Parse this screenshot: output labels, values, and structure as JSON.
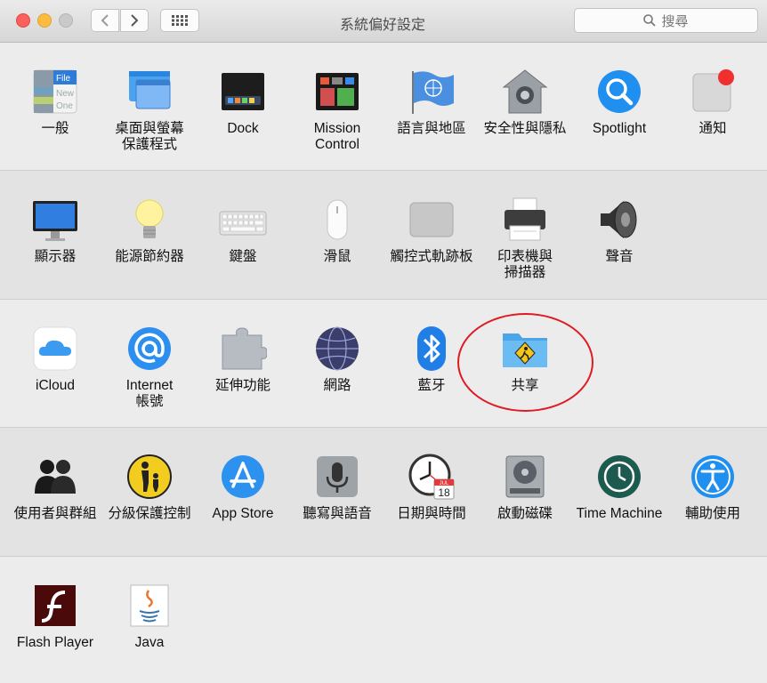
{
  "window": {
    "title": "系統偏好設定"
  },
  "search": {
    "placeholder": "搜尋"
  },
  "sections": [
    {
      "items": [
        {
          "label": "一般",
          "icon": "general-icon"
        },
        {
          "label": "桌面與螢幕\n保護程式",
          "icon": "desktop-screensaver-icon"
        },
        {
          "label": "Dock",
          "icon": "dock-icon"
        },
        {
          "label": "Mission\nControl",
          "icon": "mission-control-icon"
        },
        {
          "label": "語言與地區",
          "icon": "language-region-icon"
        },
        {
          "label": "安全性與隱私",
          "icon": "security-privacy-icon"
        },
        {
          "label": "Spotlight",
          "icon": "spotlight-icon"
        },
        {
          "label": "通知",
          "icon": "notifications-icon"
        }
      ]
    },
    {
      "items": [
        {
          "label": "顯示器",
          "icon": "displays-icon"
        },
        {
          "label": "能源節約器",
          "icon": "energy-saver-icon"
        },
        {
          "label": "鍵盤",
          "icon": "keyboard-icon"
        },
        {
          "label": "滑鼠",
          "icon": "mouse-icon"
        },
        {
          "label": "觸控式軌跡板",
          "icon": "trackpad-icon"
        },
        {
          "label": "印表機與\n掃描器",
          "icon": "printers-scanners-icon"
        },
        {
          "label": "聲音",
          "icon": "sound-icon"
        }
      ]
    },
    {
      "items": [
        {
          "label": "iCloud",
          "icon": "icloud-icon"
        },
        {
          "label": "Internet\n帳號",
          "icon": "internet-accounts-icon"
        },
        {
          "label": "延伸功能",
          "icon": "extensions-icon"
        },
        {
          "label": "網路",
          "icon": "network-icon"
        },
        {
          "label": "藍牙",
          "icon": "bluetooth-icon"
        },
        {
          "label": "共享",
          "icon": "sharing-icon"
        }
      ]
    },
    {
      "items": [
        {
          "label": "使用者與群組",
          "icon": "users-groups-icon"
        },
        {
          "label": "分級保護控制",
          "icon": "parental-controls-icon"
        },
        {
          "label": "App Store",
          "icon": "app-store-icon"
        },
        {
          "label": "聽寫與語音",
          "icon": "dictation-speech-icon"
        },
        {
          "label": "日期與時間",
          "icon": "date-time-icon"
        },
        {
          "label": "啟動磁碟",
          "icon": "startup-disk-icon"
        },
        {
          "label": "Time Machine",
          "icon": "time-machine-icon"
        },
        {
          "label": "輔助使用",
          "icon": "accessibility-icon"
        }
      ]
    },
    {
      "items": [
        {
          "label": "Flash Player",
          "icon": "flash-player-icon"
        },
        {
          "label": "Java",
          "icon": "java-icon"
        }
      ]
    }
  ],
  "icon_texts": {
    "general_file": "File",
    "general_new": "New",
    "general_one": "One",
    "calendar_month": "JUL",
    "calendar_day": "18"
  },
  "highlight": {
    "target": "共享",
    "color": "#e01a24"
  }
}
